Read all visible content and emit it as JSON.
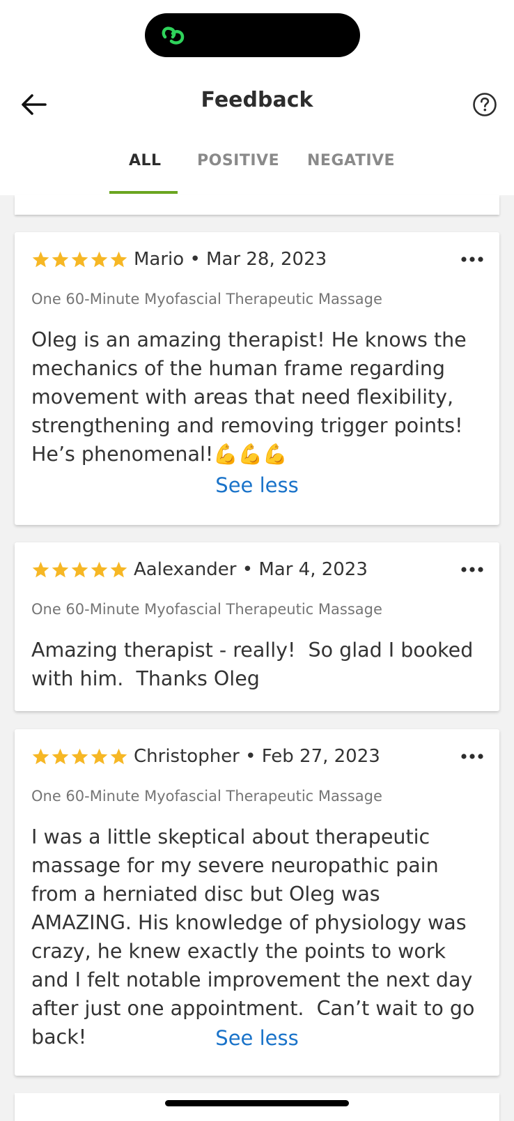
{
  "header": {
    "title": "Feedback",
    "back_icon": "arrow-left-icon",
    "help_icon": "question-circle-icon"
  },
  "tabs": [
    {
      "label": "ALL",
      "active": true
    },
    {
      "label": "POSITIVE",
      "active": false
    },
    {
      "label": "NEGATIVE",
      "active": false
    }
  ],
  "colors": {
    "accent_green": "#6aa520",
    "star_gold": "#f6b725",
    "link_blue": "#1a73c9"
  },
  "reviews": [
    {
      "rating": 5,
      "author_line": "Mario • Mar 28, 2023",
      "service": "One 60-Minute Myofascial Therapeutic Massage",
      "text": "Oleg is an amazing therapist! He knows the mechanics of the human frame regarding movement with areas that need flexibility, strengthening and removing trigger points! He’s phenomenal!💪💪💪",
      "toggle": "See less"
    },
    {
      "rating": 5,
      "author_line": "Aalexander • Mar 4, 2023",
      "service": "One 60-Minute Myofascial Therapeutic Massage",
      "text": "Amazing therapist - really!  So glad I booked with him.  Thanks Oleg"
    },
    {
      "rating": 5,
      "author_line": "Christopher • Feb 27, 2023",
      "service": "One 60-Minute Myofascial Therapeutic Massage",
      "text": "I was a little skeptical about therapeutic massage for my severe neuropathic pain from a herniated disc but Oleg was AMAZING. His knowledge of physiology was crazy, he knew exactly the points to work and I felt notable improvement the next day after just one appointment.  Can’t wait to go back!",
      "toggle": "See less"
    }
  ]
}
